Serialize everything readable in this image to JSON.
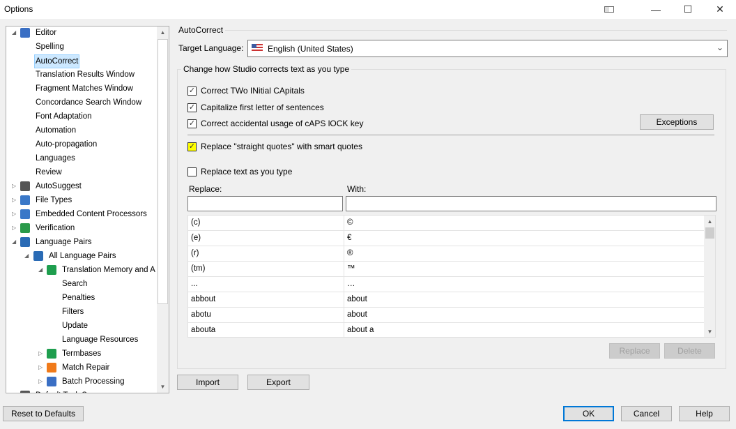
{
  "window": {
    "title": "Options",
    "controls": {
      "restore_icon": "window-snap-icon",
      "minimize": "—",
      "maximize": "☐",
      "close": "✕"
    }
  },
  "tree": {
    "items": [
      {
        "label": "Editor",
        "level": 0,
        "expanded": true,
        "icon": "pencil-icon"
      },
      {
        "label": "Spelling",
        "level": 1
      },
      {
        "label": "AutoCorrect",
        "level": 1,
        "selected": true
      },
      {
        "label": "Translation Results Window",
        "level": 1
      },
      {
        "label": "Fragment Matches Window",
        "level": 1
      },
      {
        "label": "Concordance Search Window",
        "level": 1
      },
      {
        "label": "Font Adaptation",
        "level": 1
      },
      {
        "label": "Automation",
        "level": 1
      },
      {
        "label": "Auto-propagation",
        "level": 1
      },
      {
        "label": "Languages",
        "level": 1
      },
      {
        "label": "Review",
        "level": 1
      },
      {
        "label": "AutoSuggest",
        "level": 0,
        "expanded": false,
        "icon": "autosuggest-icon"
      },
      {
        "label": "File Types",
        "level": 0,
        "expanded": false,
        "icon": "gear-document-icon"
      },
      {
        "label": "Embedded Content Processors",
        "level": 0,
        "expanded": false,
        "icon": "gear-document-icon"
      },
      {
        "label": "Verification",
        "level": 0,
        "expanded": false,
        "icon": "verification-icon"
      },
      {
        "label": "Language Pairs",
        "level": 0,
        "expanded": true,
        "icon": "globe-icon"
      },
      {
        "label": "All Language Pairs",
        "level": 1,
        "expanded": true,
        "icon": "globe-icon"
      },
      {
        "label": "Translation Memory and A",
        "level": 2,
        "expanded": true,
        "icon": "translation-memory-icon"
      },
      {
        "label": "Search",
        "level": 3
      },
      {
        "label": "Penalties",
        "level": 3
      },
      {
        "label": "Filters",
        "level": 3
      },
      {
        "label": "Update",
        "level": 3
      },
      {
        "label": "Language Resources",
        "level": 3
      },
      {
        "label": "Termbases",
        "level": 2,
        "expanded": false,
        "icon": "termbase-icon"
      },
      {
        "label": "Match Repair",
        "level": 2,
        "expanded": false,
        "icon": "wrench-icon"
      },
      {
        "label": "Batch Processing",
        "level": 2,
        "expanded": false,
        "icon": "batch-icon"
      },
      {
        "label": "Default Task S",
        "level": 0,
        "expanded": false,
        "icon": "task-icon"
      }
    ]
  },
  "autocorrect": {
    "section_title": "AutoCorrect",
    "target_language_label": "Target Language:",
    "target_language_value": "English (United States)",
    "group_title": "Change how Studio corrects text as you type",
    "options": [
      {
        "label": "Correct TWo INitial CApitals",
        "checked": true
      },
      {
        "label": "Capitalize first letter of sentences",
        "checked": true
      },
      {
        "label": "Correct accidental usage of cAPS lOCK key",
        "checked": true
      },
      {
        "label": "Replace \"straight quotes\" with smart quotes",
        "checked": true,
        "highlight": "#ffff00"
      },
      {
        "label": "Replace text as you type",
        "checked": false
      }
    ],
    "exceptions_button": "Exceptions",
    "replace_header": "Replace:",
    "with_header": "With:",
    "replace_input": "",
    "with_input": "",
    "rows": [
      [
        "(c)",
        "©"
      ],
      [
        "(e)",
        "€"
      ],
      [
        "(r)",
        "®"
      ],
      [
        "(tm)",
        "™"
      ],
      [
        "...",
        "…"
      ],
      [
        "abbout",
        "about"
      ],
      [
        "abotu",
        "about"
      ],
      [
        "abouta",
        "about a"
      ]
    ],
    "replace_button": "Replace",
    "delete_button": "Delete",
    "import_button": "Import",
    "export_button": "Export"
  },
  "footer": {
    "reset": "Reset to Defaults",
    "ok": "OK",
    "cancel": "Cancel",
    "help": "Help"
  }
}
